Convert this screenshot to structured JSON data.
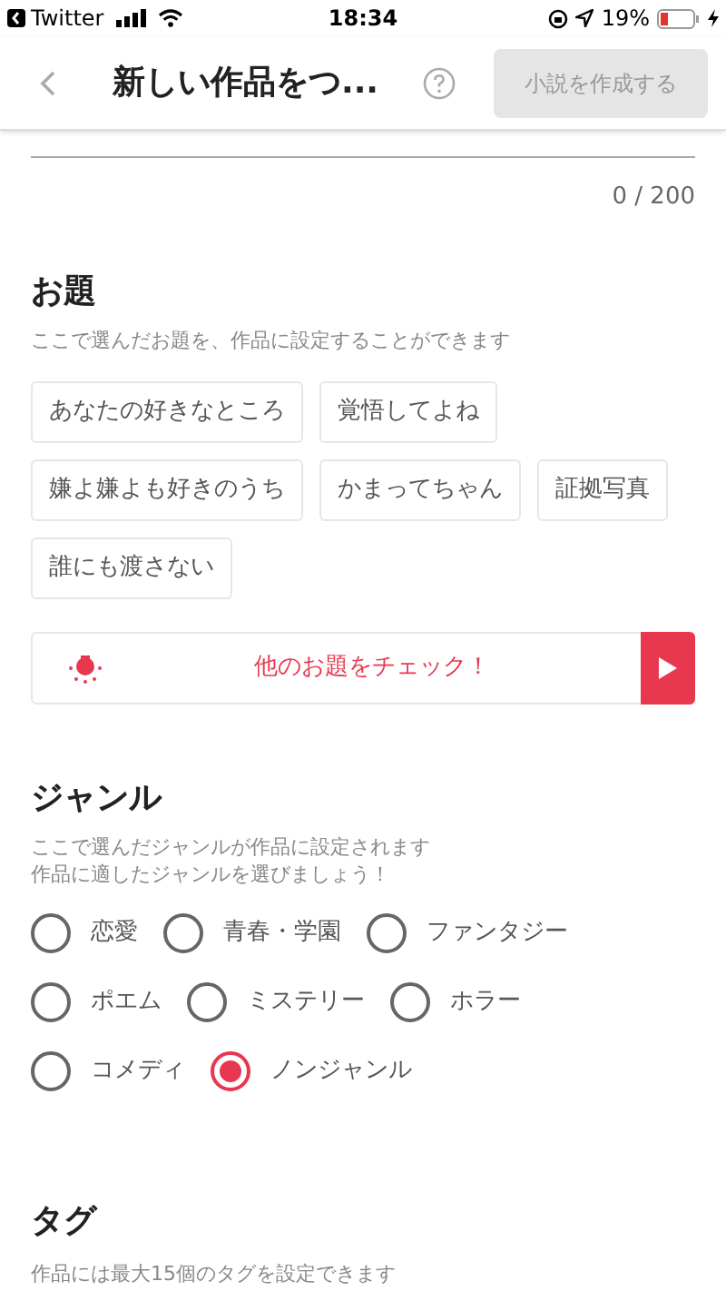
{
  "status_bar": {
    "back_app": "Twitter",
    "time": "18:34",
    "battery": "19%"
  },
  "header": {
    "title": "新しい作品をつ...",
    "action": {
      "label": "小説を作成する",
      "disabled": true
    }
  },
  "counter": "0 / 200",
  "theme_section": {
    "title": "お題",
    "description": "ここで選んだお題を、作品に設定することができます",
    "themes": [
      {
        "label": "あなたの好きなところ"
      },
      {
        "label": "覚悟してよね"
      },
      {
        "label": "嫌よ嫌よも好きのうち"
      },
      {
        "label": "かまってちゃん"
      },
      {
        "label": "証拠写真"
      },
      {
        "label": "誰にも渡さない"
      }
    ],
    "check_button": "他のお題をチェック！"
  },
  "genre_section": {
    "title": "ジャンル",
    "description": [
      "ここで選んだジャンルが作品に設定されます",
      "作品に適したジャンルを選びましょう！"
    ],
    "genres": [
      {
        "label": "恋愛",
        "selected": false
      },
      {
        "label": "青春・学園",
        "selected": false
      },
      {
        "label": "ファンタジー",
        "selected": false
      },
      {
        "label": "ポエム",
        "selected": false
      },
      {
        "label": "ミステリー",
        "selected": false
      },
      {
        "label": "ホラー",
        "selected": false
      },
      {
        "label": "コメディ",
        "selected": false
      },
      {
        "label": "ノンジャンル",
        "selected": true
      }
    ]
  },
  "tag_section": {
    "title": "タグ",
    "description": "作品には最大15個のタグを設定できます"
  }
}
